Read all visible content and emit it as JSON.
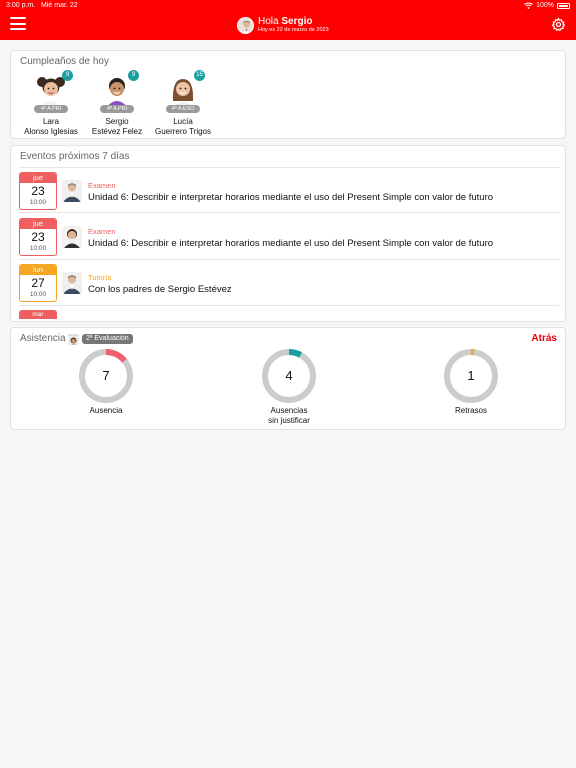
{
  "status_bar": {
    "time": "3:00 p.m.",
    "date": "Mié mar. 22",
    "battery": "100%"
  },
  "header": {
    "greeting_prefix": "Hola",
    "user_name": "Sergio",
    "date_text": "Hoy es 22 de marzo de 2023"
  },
  "birthdays": {
    "title": "Cumpleaños de hoy",
    "people": [
      {
        "first_name": "Lara",
        "last_name": "Alonso Iglesias",
        "age": "9",
        "class": "4º A PRI"
      },
      {
        "first_name": "Sergio",
        "last_name": "Estévez Felez",
        "age": "9",
        "class": "4º A PRI"
      },
      {
        "first_name": "Lucía",
        "last_name": "Guerrero Trigos",
        "age": "15",
        "class": "4º A ESO"
      }
    ]
  },
  "events": {
    "title": "Eventos próximos 7 días",
    "items": [
      {
        "weekday": "jue",
        "day": "23",
        "time": "10:00",
        "type": "Examen",
        "description": "Unidad 6: Describir e interpretar horarios mediante el uso del Present Simple con valor de futuro",
        "color": "#ef5f5f"
      },
      {
        "weekday": "jue",
        "day": "23",
        "time": "10:00",
        "type": "Examen",
        "description": "Unidad 6: Describir e interpretar horarios mediante el uso del Present Simple con valor de futuro",
        "color": "#ef5f5f"
      },
      {
        "weekday": "lun",
        "day": "27",
        "time": "10:00",
        "type": "Tutoría",
        "description": "Con los padres de Sergio Estévez",
        "color": "#f5a623"
      }
    ],
    "next_partial_weekday": "mar"
  },
  "attendance": {
    "title": "Asistencia",
    "evaluation": "2ª Evaluación",
    "back_label": "Atrás",
    "gauges": [
      {
        "value": "7",
        "label": "Ausencia",
        "fraction": 0.14,
        "color": "#ef5f6f"
      },
      {
        "value": "4",
        "label": "Ausencias\nsin justificar",
        "fraction": 0.08,
        "color": "#1aa0a0"
      },
      {
        "value": "1",
        "label": "Retrasos",
        "fraction": 0.02,
        "color": "#f5a623"
      }
    ]
  },
  "colors": {
    "brand": "#ff0000",
    "exam": "#ef5f5f",
    "tutoring": "#f5a623",
    "teal": "#1aa0a0"
  }
}
